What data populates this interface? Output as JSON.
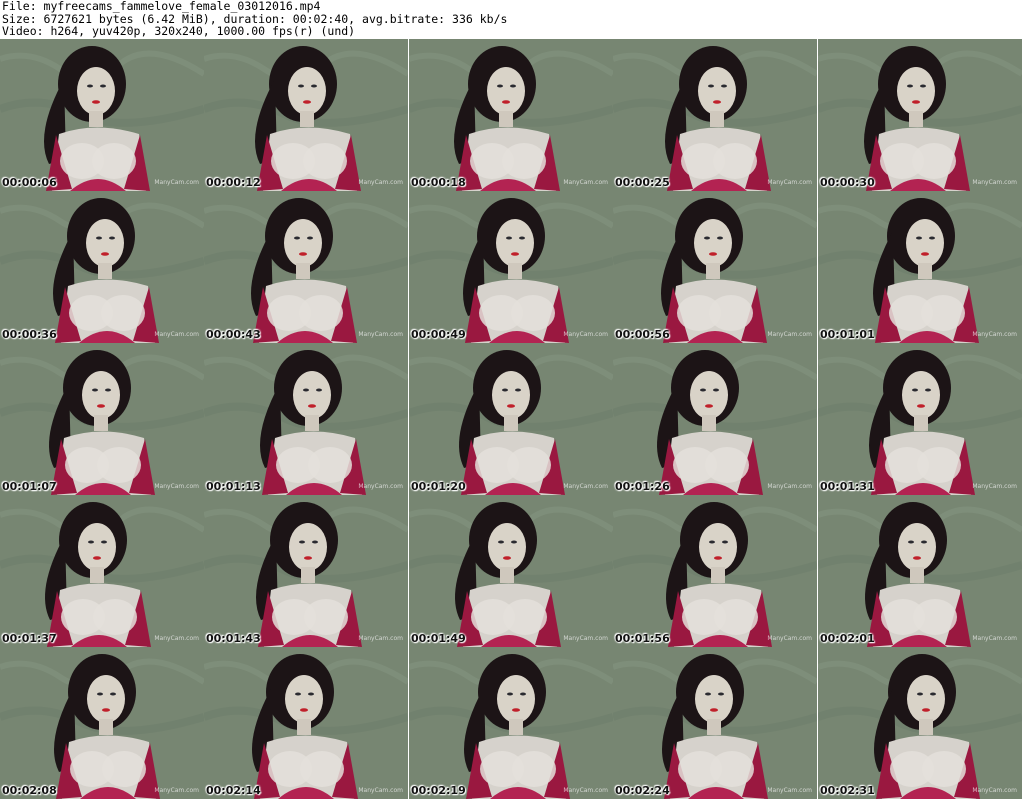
{
  "header": {
    "file_line": "File: myfreecams_fammelove_female_03012016.mp4",
    "size_line": "Size: 6727621 bytes (6.42 MiB), duration: 00:02:40, avg.bitrate: 336 kb/s",
    "video_line": "Video: h264, yuv420p, 320x240, 1000.00 fps(r) (und)"
  },
  "watermark": "ManyCam.com",
  "thumbnails": [
    {
      "timestamp": "00:00:06"
    },
    {
      "timestamp": "00:00:12"
    },
    {
      "timestamp": "00:00:18"
    },
    {
      "timestamp": "00:00:25"
    },
    {
      "timestamp": "00:00:30"
    },
    {
      "timestamp": "00:00:36"
    },
    {
      "timestamp": "00:00:43"
    },
    {
      "timestamp": "00:00:49"
    },
    {
      "timestamp": "00:00:56"
    },
    {
      "timestamp": "00:01:01"
    },
    {
      "timestamp": "00:01:07"
    },
    {
      "timestamp": "00:01:13"
    },
    {
      "timestamp": "00:01:20"
    },
    {
      "timestamp": "00:01:26"
    },
    {
      "timestamp": "00:01:31"
    },
    {
      "timestamp": "00:01:37"
    },
    {
      "timestamp": "00:01:43"
    },
    {
      "timestamp": "00:01:49"
    },
    {
      "timestamp": "00:01:56"
    },
    {
      "timestamp": "00:02:01"
    },
    {
      "timestamp": "00:02:08"
    },
    {
      "timestamp": "00:02:14"
    },
    {
      "timestamp": "00:02:19"
    },
    {
      "timestamp": "00:02:24"
    },
    {
      "timestamp": "00:02:31"
    }
  ]
}
